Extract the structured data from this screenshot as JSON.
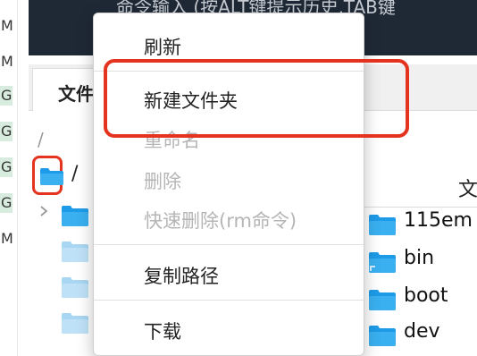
{
  "gutter": {
    "letters": [
      "M",
      "M",
      "G",
      "G",
      "G",
      "G",
      "M"
    ],
    "highlighted": [
      false,
      false,
      true,
      true,
      true,
      true,
      false
    ]
  },
  "command_bar": {
    "text": "命令输入 (按ALT键提示历史,TAB键"
  },
  "tab": {
    "label": "文件"
  },
  "path": "/",
  "root": {
    "name": "/"
  },
  "column_header": {
    "label": "文"
  },
  "files": [
    {
      "name": "115em"
    },
    {
      "name": "bin"
    },
    {
      "name": "boot"
    },
    {
      "name": "dev"
    }
  ],
  "context_menu": {
    "refresh": "刷新",
    "new_folder": "新建文件夹",
    "rename": "重命名",
    "delete": "删除",
    "quick_delete": "快速删除(rm命令)",
    "copy_path": "复制路径",
    "download": "下载"
  },
  "colors": {
    "accent_red": "#e4341f",
    "folder_blue": "#1e9be8",
    "command_bar_bg": "#1f2936",
    "gutter_highlight": "#d7ecdf"
  }
}
